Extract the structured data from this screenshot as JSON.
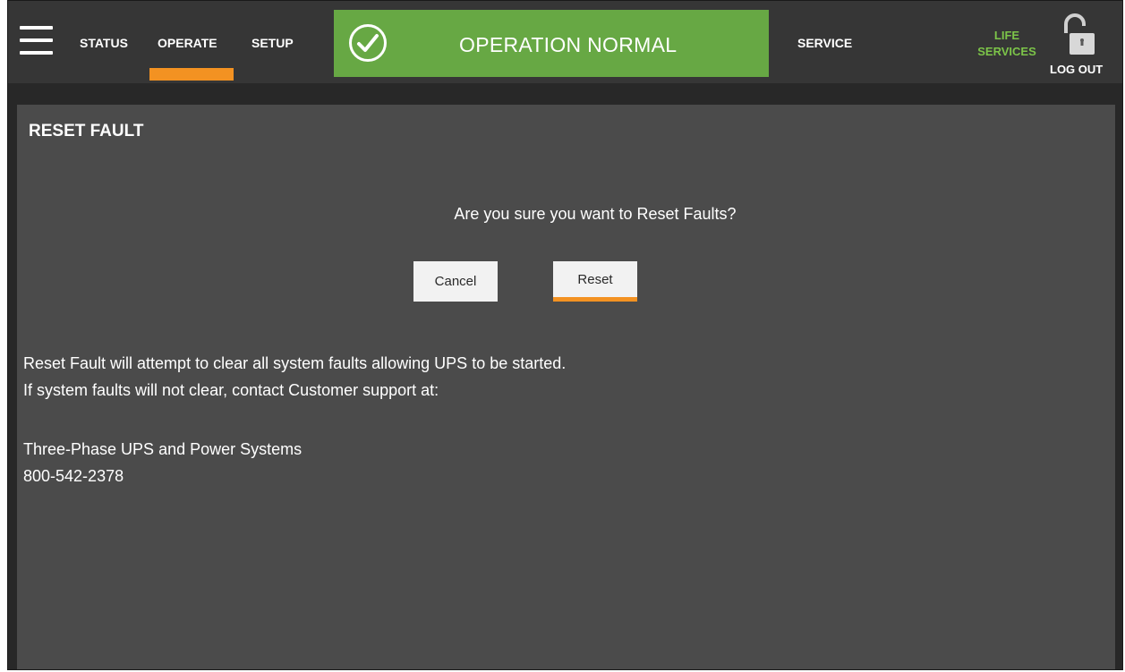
{
  "header": {
    "nav": {
      "status": "STATUS",
      "operate": "OPERATE",
      "setup": "SETUP",
      "service": "SERVICE"
    },
    "active_tab": "OPERATE",
    "status_banner": {
      "text": "OPERATION NORMAL",
      "color": "#67a844"
    },
    "life_services": {
      "line1": "LIFE",
      "line2": "SERVICES",
      "color": "#7cc449"
    },
    "logout_label": "LOG OUT",
    "icons": {
      "menu": "hamburger-menu-icon",
      "status": "checkmark-circle-icon",
      "logout": "unlocked-padlock-icon"
    },
    "accent_color": "#f39222"
  },
  "dialog": {
    "title": "RESET FAULT",
    "question": "Are you sure you want to Reset Faults?",
    "cancel_label": "Cancel",
    "reset_label": "Reset",
    "info_line1": "Reset Fault will attempt to clear all system faults allowing UPS to be started.",
    "info_line2": "If system faults will not clear, contact Customer support at:",
    "contact_name": "Three-Phase UPS and Power Systems",
    "contact_phone": "800-542-2378"
  }
}
